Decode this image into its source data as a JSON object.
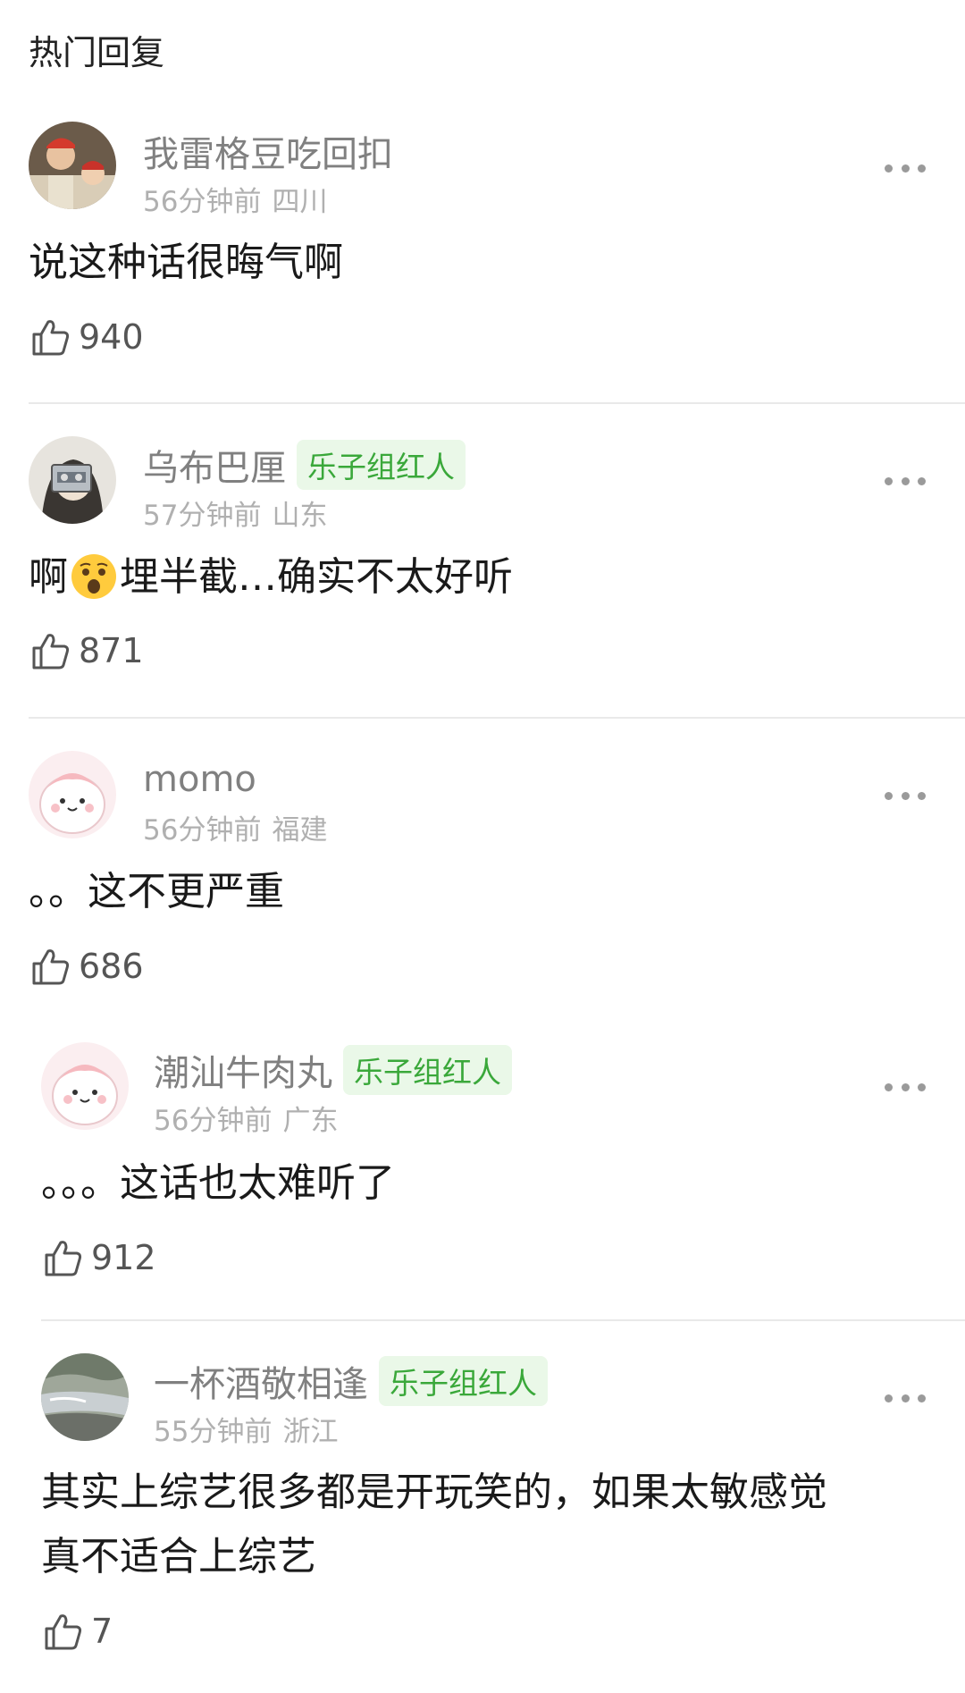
{
  "section_title": "热门回复",
  "comments": [
    {
      "name": "我雷格豆吃回扣",
      "badge": "",
      "time": "56分钟前",
      "region": "四川",
      "text_before": "说这种话很晦气啊",
      "text_after": "",
      "likes": "940",
      "avatar_icon": "photo-avatar"
    },
    {
      "name": "乌布巴厘",
      "badge": "乐子组红人",
      "time": "57分钟前",
      "region": "山东",
      "text_before": "啊",
      "text_after": "埋半截…确实不太好听",
      "likes": "871",
      "avatar_icon": "photo-avatar"
    },
    {
      "name": "momo",
      "badge": "",
      "time": "56分钟前",
      "region": "福建",
      "text_before": "。。这不更严重",
      "text_after": "",
      "likes": "686",
      "avatar_icon": "cartoon-avatar"
    },
    {
      "name": "潮汕牛肉丸",
      "badge": "乐子组红人",
      "time": "56分钟前",
      "region": "广东",
      "text_before": "。。。这话也太难听了",
      "text_after": "",
      "likes": "912",
      "avatar_icon": "cartoon-avatar"
    },
    {
      "name": "一杯酒敬相逢",
      "badge": "乐子组红人",
      "time": "55分钟前",
      "region": "浙江",
      "text_line1": "其实上综艺很多都是开玩笑的，如果太敏感觉",
      "text_line2": "真不适合上综艺",
      "likes": "7",
      "avatar_icon": "landscape-avatar"
    }
  ],
  "colors": {
    "badge_text": "#3aa83a",
    "badge_bg": "#eaf8e8",
    "name": "#808080",
    "meta": "#b0b0b0"
  }
}
